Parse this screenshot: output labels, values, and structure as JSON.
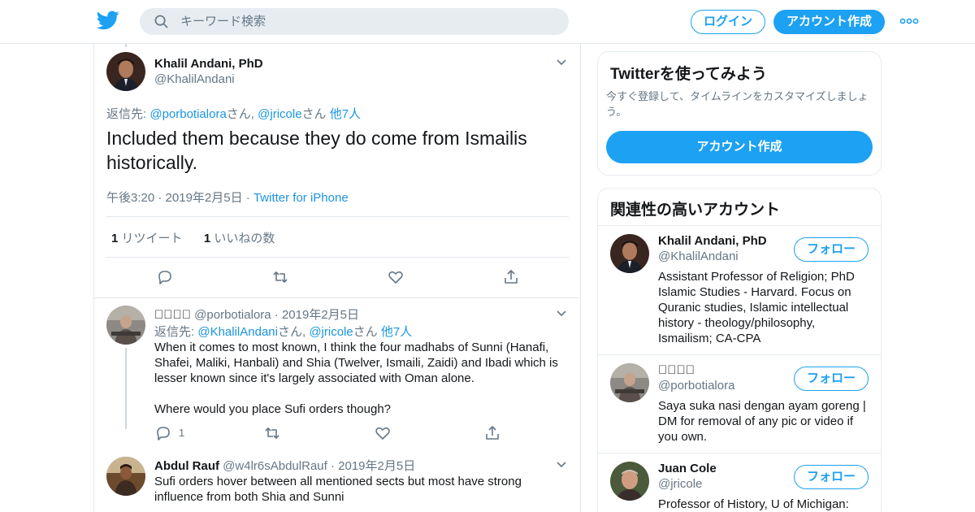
{
  "header": {
    "search_placeholder": "キーワード検索",
    "login_label": "ログイン",
    "signup_label": "アカウント作成"
  },
  "colors": {
    "brand": "#1da1f2",
    "link": "#1b95e0",
    "muted": "#657786",
    "border": "#e1e8ed"
  },
  "main_tweet": {
    "name": "Khalil Andani, PhD",
    "handle": "@KhalilAndani",
    "reply_prefix": "返信先: ",
    "reply_user1": "@porbotialora",
    "reply_san1": "さん, ",
    "reply_user2": "@jricole",
    "reply_san2": "さん ",
    "reply_others": "他7人",
    "text": "Included them because they do come from Ismailis historically.",
    "time": "午後3:20",
    "date": "2019年2月5日",
    "source": "Twitter for iPhone",
    "retweet_count": "1",
    "retweet_label": "リツイート",
    "like_count": "1",
    "like_label": "いいねの数"
  },
  "replies": [
    {
      "name": "􀀀􀀀􀀀􀀀",
      "handle": "@porbotialora",
      "date": "2019年2月5日",
      "reply_prefix": "返信先: ",
      "reply_user1": "@KhalilAndani",
      "reply_san1": "さん, ",
      "reply_user2": "@jricole",
      "reply_san2": "さん ",
      "reply_others": "他7人",
      "text_p1": "When it comes to most known, I think the four madhabs of Sunni (Hanafi, Shafei, Maliki, Hanbali) and Shia (Twelver, Ismaili, Zaidi) and Ibadi which is lesser known since it's largely associated with Oman alone.",
      "text_p2": "Where would you place Sufi orders though?",
      "reply_count": "1"
    },
    {
      "name": "Abdul Rauf",
      "handle": "@w4lr6sAbdulRauf",
      "date": "2019年2月5日",
      "text": "Sufi orders hover between all mentioned sects but most have strong influence from both Shia and Sunni"
    }
  ],
  "sidebar": {
    "signup_card": {
      "title": "Twitterを使ってみよう",
      "subtitle": "今すぐ登録して、タイムラインをカスタマイズしましょう。",
      "button": "アカウント作成"
    },
    "related": {
      "title": "関連性の高いアカウント",
      "follow_label": "フォロー",
      "accounts": [
        {
          "name": "Khalil Andani, PhD",
          "handle": "@KhalilAndani",
          "bio": "Assistant Professor of Religion; PhD Islamic Studies - Harvard. Focus on Quranic studies, Islamic intellectual history - theology/philosophy, Ismailism; CA-CPA"
        },
        {
          "name": "􀀀􀀀􀀀􀀀",
          "handle": "@porbotialora",
          "bio": "Saya suka nasi dengan ayam goreng | DM for removal of any pic or video if you own."
        },
        {
          "name": "Juan Cole",
          "handle": "@jricole",
          "bio": "Professor of History, U of Michigan:"
        }
      ]
    }
  }
}
